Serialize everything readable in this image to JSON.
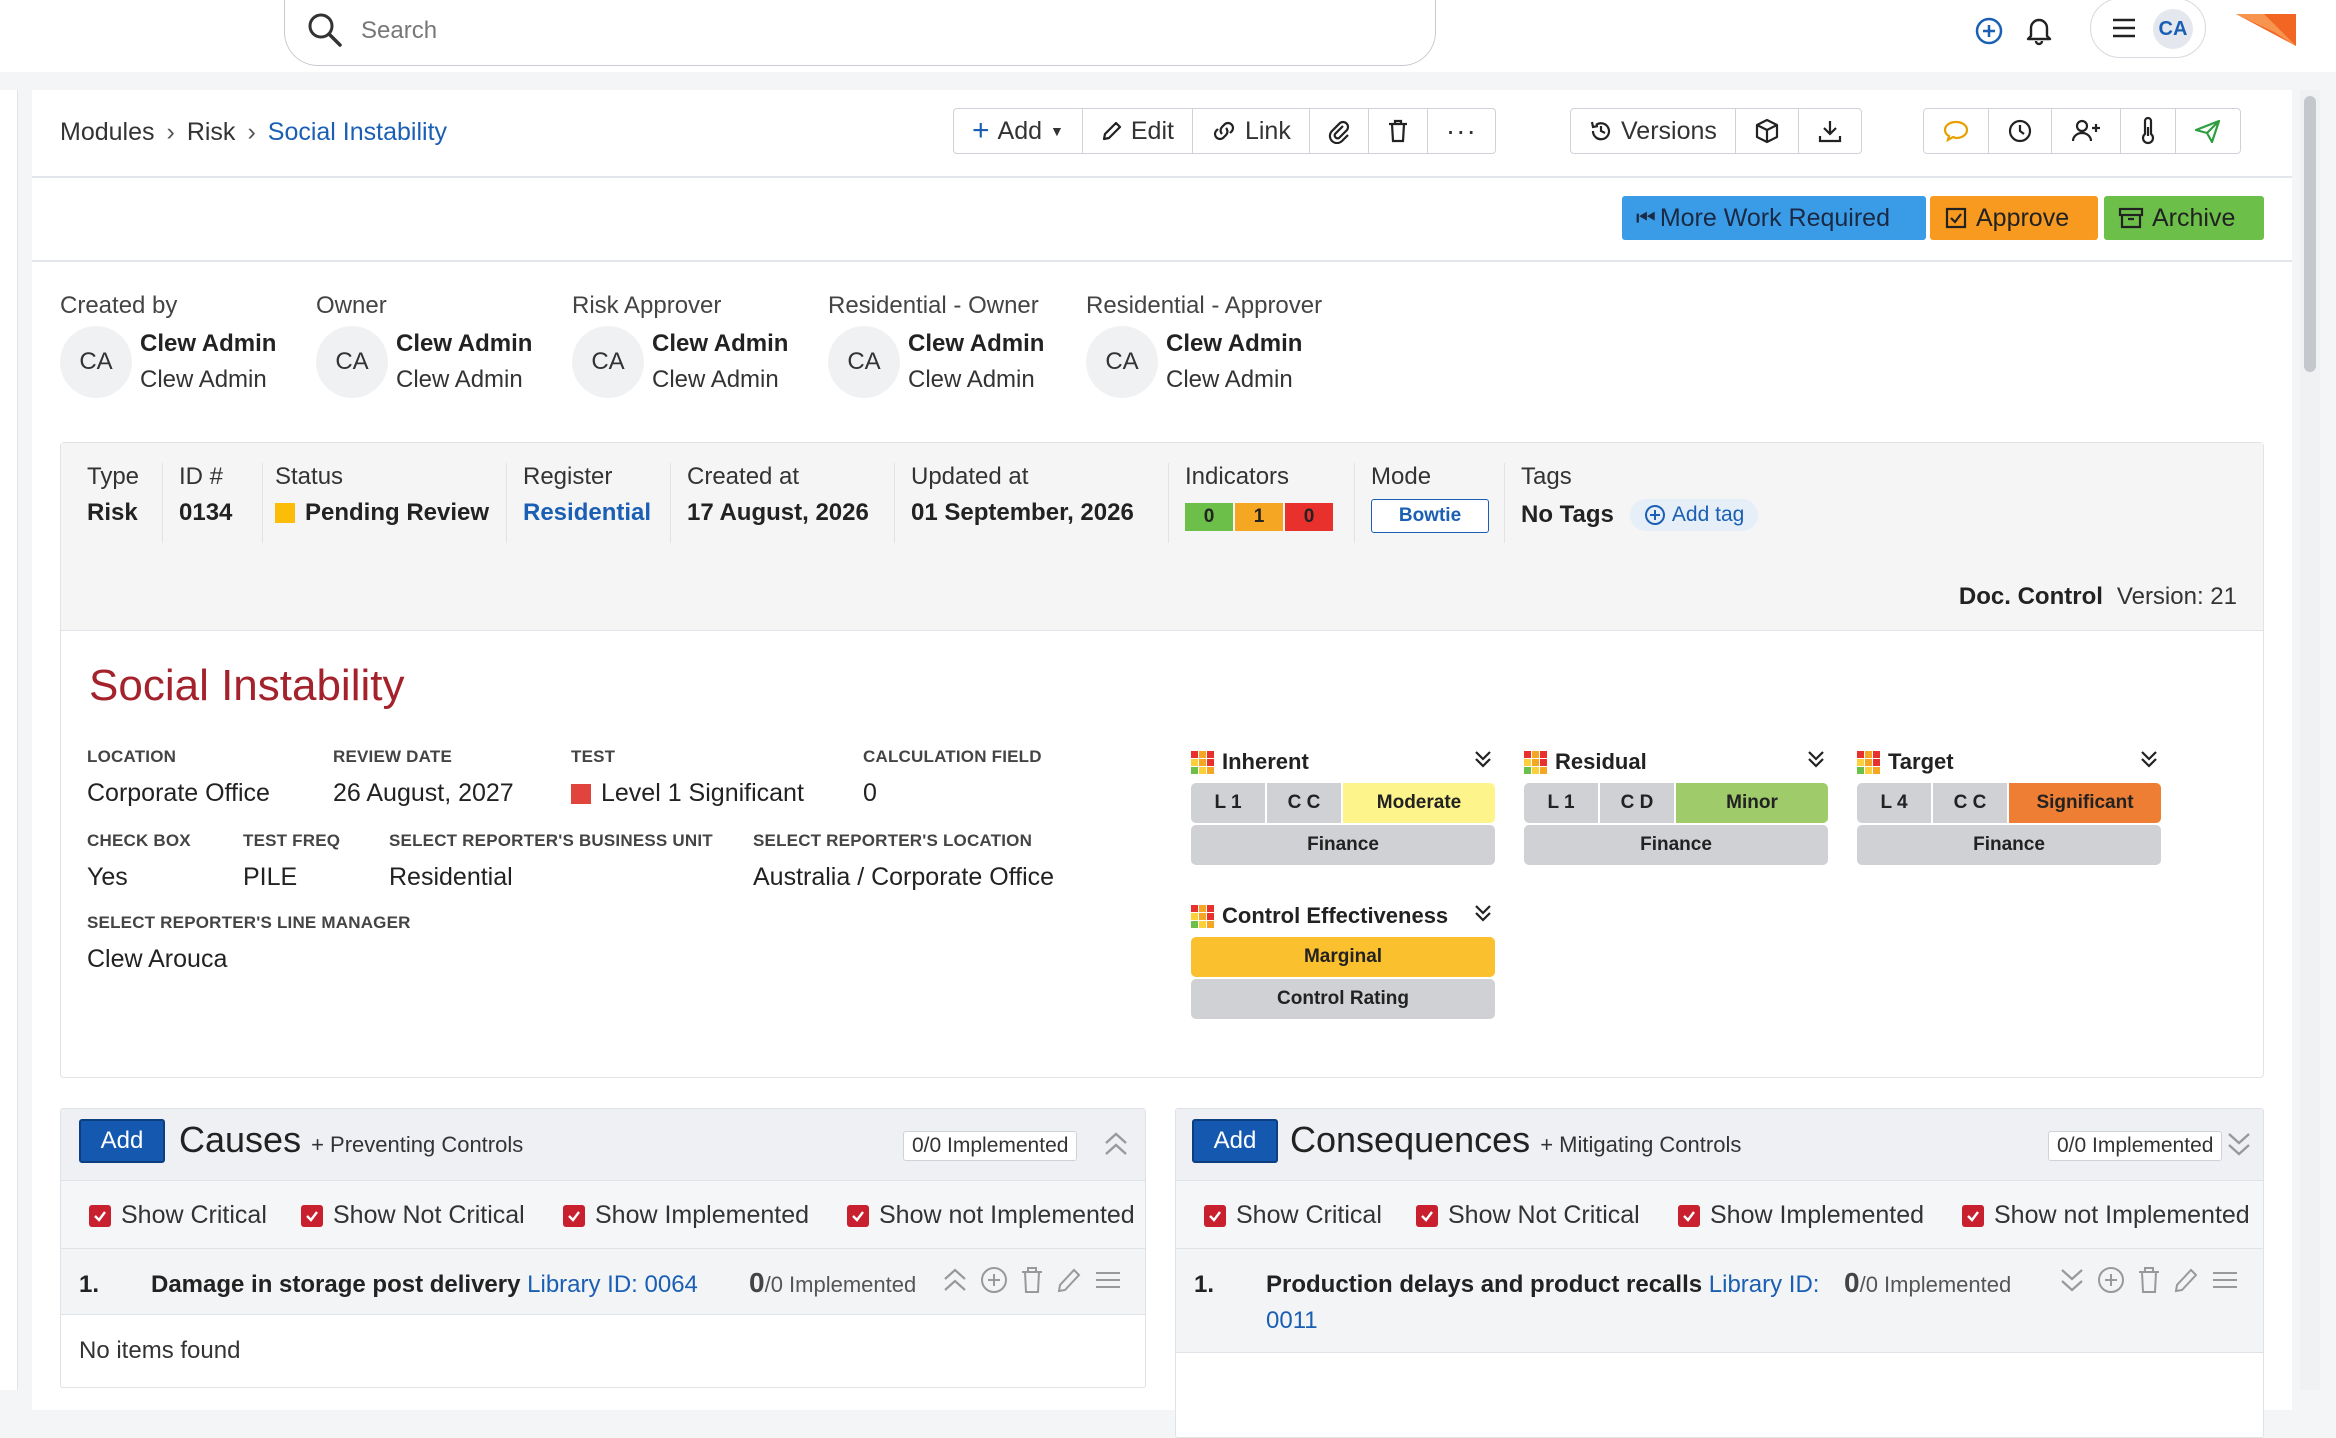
{
  "search": {
    "placeholder": "Search"
  },
  "user": {
    "initials": "CA"
  },
  "breadcrumb": {
    "items": [
      "Modules",
      "Risk"
    ],
    "current": "Social Instability"
  },
  "toolbar": {
    "add": "Add",
    "edit": "Edit",
    "link": "Link",
    "versions": "Versions"
  },
  "workflow": {
    "more_work": "More Work Required",
    "approve": "Approve",
    "archive": "Archive"
  },
  "people": [
    {
      "role": "Created by",
      "initials": "CA",
      "name": "Clew Admin",
      "sub": "Clew Admin"
    },
    {
      "role": "Owner",
      "initials": "CA",
      "name": "Clew Admin",
      "sub": "Clew Admin"
    },
    {
      "role": "Risk Approver",
      "initials": "CA",
      "name": "Clew Admin",
      "sub": "Clew Admin"
    },
    {
      "role": "Residential - Owner",
      "initials": "CA",
      "name": "Clew Admin",
      "sub": "Clew Admin"
    },
    {
      "role": "Residential - Approver",
      "initials": "CA",
      "name": "Clew Admin",
      "sub": "Clew Admin"
    }
  ],
  "info": {
    "type_label": "Type",
    "type": "Risk",
    "id_label": "ID #",
    "id": "0134",
    "status_label": "Status",
    "status": "Pending Review",
    "register_label": "Register",
    "register": "Residential",
    "created_label": "Created at",
    "created": "17 August, 2026",
    "updated_label": "Updated at",
    "updated": "01 September, 2026",
    "indicators_label": "Indicators",
    "indicators": [
      "0",
      "1",
      "0"
    ],
    "mode_label": "Mode",
    "mode": "Bowtie",
    "tags_label": "Tags",
    "tags": "No Tags",
    "add_tag": "Add tag"
  },
  "doc_control": {
    "label": "Doc. Control",
    "version": "Version: 21"
  },
  "record": {
    "title": "Social Instability"
  },
  "fields": {
    "location_label": "LOCATION",
    "location": "Corporate Office",
    "review_label": "REVIEW DATE",
    "review": "26 August, 2027",
    "test_label": "TEST",
    "test": "Level 1 Significant",
    "calc_label": "CALCULATION FIELD",
    "calc": "0",
    "checkbox_label": "CHECK BOX",
    "checkbox": "Yes",
    "testfreq_label": "TEST FREQ",
    "testfreq": "PILE",
    "bu_label": "SELECT REPORTER'S BUSINESS UNIT",
    "bu": "Residential",
    "loc2_label": "SELECT REPORTER'S LOCATION",
    "loc2": "Australia / Corporate Office",
    "manager_label": "SELECT REPORTER'S LINE MANAGER",
    "manager": "Clew Arouca"
  },
  "ratings": {
    "inherent": {
      "title": "Inherent",
      "l": "L 1",
      "c": "C C",
      "level": "Moderate",
      "sub": "Finance"
    },
    "residual": {
      "title": "Residual",
      "l": "L 1",
      "c": "C D",
      "level": "Minor",
      "sub": "Finance"
    },
    "target": {
      "title": "Target",
      "l": "L 4",
      "c": "C C",
      "level": "Significant",
      "sub": "Finance"
    },
    "control": {
      "title": "Control Effectiveness",
      "level": "Marginal",
      "sub": "Control Rating"
    }
  },
  "colors": {
    "moderate": "#fdf58b",
    "minor": "#9fcb6b",
    "significant": "#ee7e33",
    "marginal": "#fbc02d",
    "accent": "#1a5fb4"
  },
  "causes": {
    "add": "Add",
    "title": "Causes",
    "subtitle": "+ Preventing Controls",
    "implemented": "0/0 Implemented",
    "filters": [
      "Show Critical",
      "Show Not Critical",
      "Show Implemented",
      "Show not Implemented"
    ],
    "item": {
      "num": "1.",
      "name": "Damage in storage post delivery",
      "library": "Library ID: 0064",
      "count_bold": "0",
      "count_rest": "/0 Implemented"
    },
    "empty": "No items found"
  },
  "consequences": {
    "add": "Add",
    "title": "Consequences",
    "subtitle": "+ Mitigating Controls",
    "implemented": "0/0 Implemented",
    "filters": [
      "Show Critical",
      "Show Not Critical",
      "Show Implemented",
      "Show not Implemented"
    ],
    "item": {
      "num": "1.",
      "name": "Production delays and product recalls",
      "library": "Library ID:",
      "library2": "0011",
      "count_bold": "0",
      "count_rest": "/0 Implemented"
    }
  }
}
